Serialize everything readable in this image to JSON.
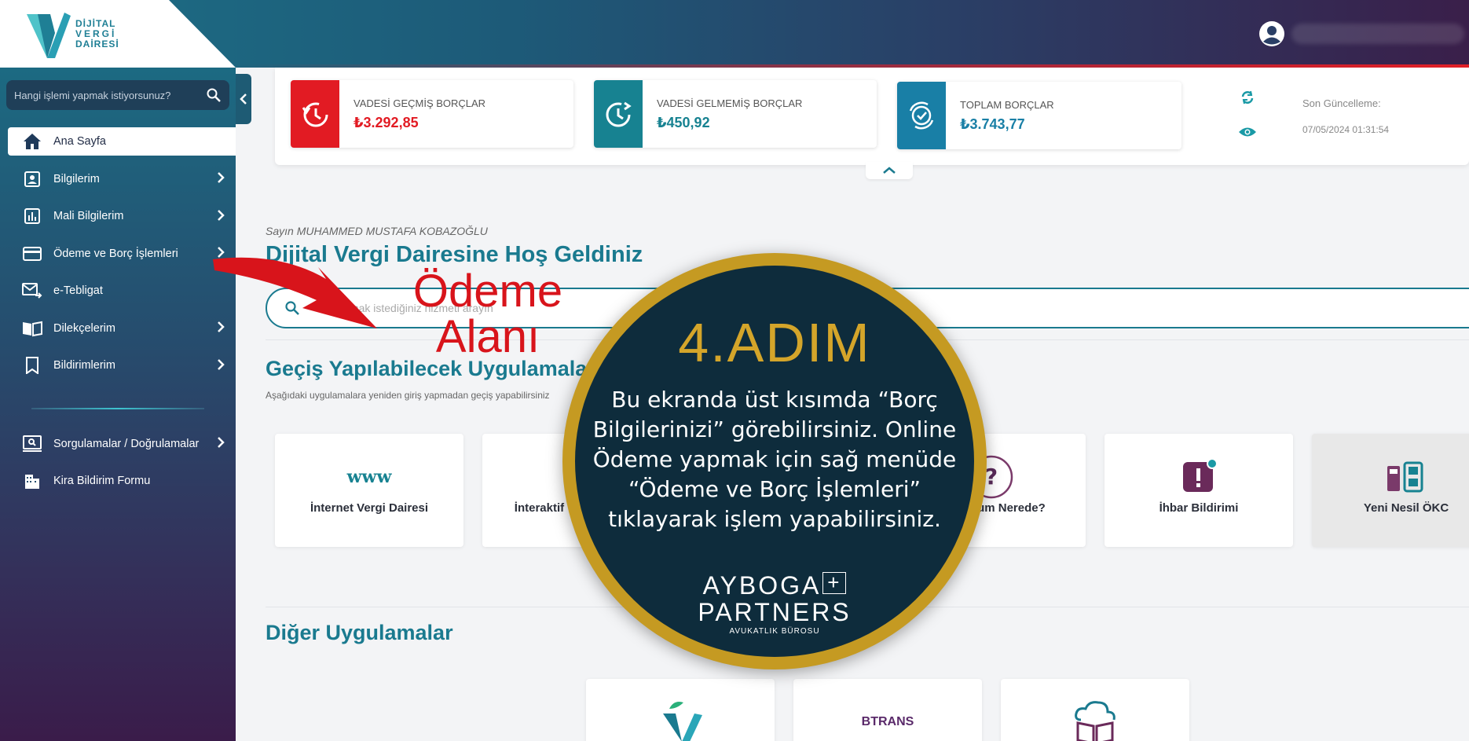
{
  "header": {
    "logo_lines": [
      "DİJİTAL",
      "VERGİ",
      "DAİRESİ"
    ]
  },
  "sidebar": {
    "search_placeholder": "Hangi işlemi yapmak istiyorsunuz?",
    "items": [
      {
        "label": "Ana Sayfa",
        "icon": "home-icon",
        "active": true
      },
      {
        "label": "Bilgilerim",
        "icon": "id-card-icon"
      },
      {
        "label": "Mali Bilgilerim",
        "icon": "bar-chart-icon"
      },
      {
        "label": "Ödeme ve Borç İşlemleri",
        "icon": "credit-card-icon"
      },
      {
        "label": "e-Tebligat",
        "icon": "mail-send-icon"
      },
      {
        "label": "Dilekçelerim",
        "icon": "book-open-icon"
      },
      {
        "label": "Bildirimlerim",
        "icon": "bookmark-icon"
      }
    ],
    "items2": [
      {
        "label": "Sorgulamalar / Doğrulamalar",
        "icon": "monitor-search-icon"
      },
      {
        "label": "Kira Bildirim Formu",
        "icon": "building-icon"
      }
    ]
  },
  "summary": {
    "overdue_label": "VADESİ GEÇMİŞ BORÇLAR",
    "overdue_amount": "₺3.292,85",
    "notdue_label": "VADESİ GELMEMİŞ BORÇLAR",
    "notdue_amount": "₺450,92",
    "total_label": "TOPLAM BORÇLAR",
    "total_amount": "₺3.743,77",
    "last_update_label": "Son Güncelleme:",
    "last_update_date": "07/05/2024 01:31:54",
    "colors": {
      "overdue": "#e21b23",
      "notdue": "#178291",
      "total": "#197fa6"
    }
  },
  "main": {
    "greeting": "Sayın MUHAMMED MUSTAFA KOBAZOĞLU",
    "welcome": "Dijital Vergi Dairesine Hoş Geldiniz",
    "search_placeholder": "Kullanmak istediğiniz hizmeti arayın",
    "apps_title": "Geçiş Yapılabilecek Uygulamalar",
    "apps_subtitle": "Aşağıdaki uygulamalara yeniden giriş yapmadan geçiş yapabilirsiniz",
    "apps": [
      {
        "name": "İnternet Vergi Dairesi",
        "icon": "www-icon"
      },
      {
        "name": "İnteraktif Vergi Dairesi",
        "icon": "v-logo-icon"
      },
      {
        "name": "",
        "icon": ""
      },
      {
        "name": "Başvurum Nerede?",
        "icon": "question-icon"
      },
      {
        "name": "İhbar Bildirimi",
        "icon": "alert-icon"
      },
      {
        "name": "Yeni Nesil ÖKC",
        "icon": "pos-device-icon"
      }
    ],
    "other_title": "Diğer Uygulamalar",
    "other_apps": [
      {
        "name": "",
        "icon": "v-leaf-logo-icon"
      },
      {
        "name": "BTRANS",
        "icon": "btrans-icon"
      },
      {
        "name": "",
        "icon": "cloud-book-icon"
      }
    ]
  },
  "overlay": {
    "arrow_label_line1": "Ödeme",
    "arrow_label_line2": "Alanı",
    "step": "4.ADIM",
    "description": "Bu ekranda üst kısımda “Borç Bilgilerinizi” görebilirsiniz. Online Ödeme yapmak için sağ menüde “Ödeme ve Borç İşlemleri” tıklayarak işlem yapabilirsiniz.",
    "brand_line1": "AYBOGA",
    "brand_plus": "+",
    "brand_line2": "PARTNERS",
    "brand_line3": "AVUKATLIK BÜROSU"
  }
}
